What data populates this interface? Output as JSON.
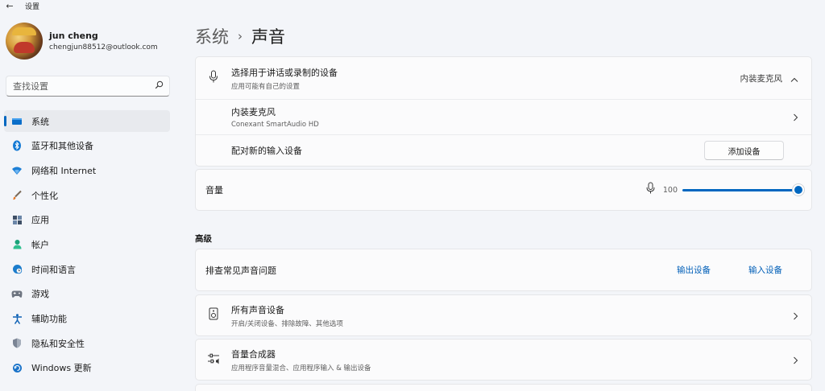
{
  "window": {
    "title": "设置",
    "back_glyph": "←"
  },
  "profile": {
    "name": "jun cheng",
    "email": "chengjun88512@outlook.com"
  },
  "search": {
    "placeholder": "查找设置"
  },
  "nav": [
    {
      "label": "系统",
      "icon": "monitor-icon",
      "active": true
    },
    {
      "label": "蓝牙和其他设备",
      "icon": "bluetooth-icon"
    },
    {
      "label": "网络和 Internet",
      "icon": "wifi-icon"
    },
    {
      "label": "个性化",
      "icon": "brush-icon"
    },
    {
      "label": "应用",
      "icon": "apps-icon"
    },
    {
      "label": "帐户",
      "icon": "person-icon"
    },
    {
      "label": "时间和语言",
      "icon": "globe-clock-icon"
    },
    {
      "label": "游戏",
      "icon": "gamepad-icon"
    },
    {
      "label": "辅助功能",
      "icon": "accessibility-icon"
    },
    {
      "label": "隐私和安全性",
      "icon": "shield-icon"
    },
    {
      "label": "Windows 更新",
      "icon": "windows-update-icon"
    }
  ],
  "breadcrumb": {
    "parent": "系统",
    "sep": "›",
    "current": "声音"
  },
  "input": {
    "title": "选择用于讲话或录制的设备",
    "subtitle": "应用可能有自己的设置",
    "selected": "内装麦克风",
    "device_name": "内装麦克风",
    "device_desc": "Conexant SmartAudio HD",
    "pair_label": "配对新的输入设备",
    "add_button": "添加设备"
  },
  "volume": {
    "label": "音量",
    "value": "100",
    "level_percent": 100
  },
  "advanced": {
    "label": "高级",
    "troubleshoot": "排查常见声音问题",
    "output_link": "输出设备",
    "input_link": "输入设备",
    "all_devices_title": "所有声音设备",
    "all_devices_sub": "开启/关闭设备、排除故障、其他选项",
    "mixer_title": "音量合成器",
    "mixer_sub": "应用程序音量混合、应用程序输入 & 输出设备"
  },
  "colors": {
    "accent": "#0067c0",
    "link": "#005fb8",
    "background": "#f3f5f9"
  }
}
